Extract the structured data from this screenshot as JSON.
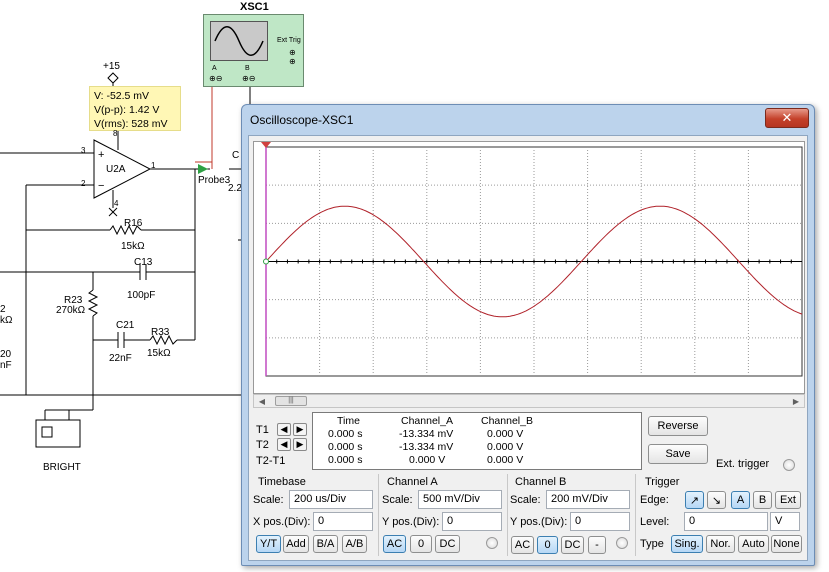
{
  "schematic": {
    "instrument_label": "XSC1",
    "instrument_ext_trig": "Ext Trig",
    "instrument_a": "A",
    "instrument_b": "B",
    "supply": "+15",
    "probe_readout": {
      "v": "V: -52.5 mV",
      "vpp": "V(p-p): 1.42 V",
      "vrms": "V(rms): 528 mV"
    },
    "opamp": "U2A",
    "pin_8": "8",
    "pin_4": "4",
    "pin_3": "3",
    "pin_2": "2",
    "pin_1": "1",
    "probe_label": "Probe3",
    "c_partial": "C",
    "val_partial": "2.2",
    "r16": "R16",
    "r16_val": "15kΩ",
    "c13": "C13",
    "c13_val": "100pF",
    "r23": "R23",
    "r23_val": "270kΩ",
    "c21": "C21",
    "c21_val": "22nF",
    "r33": "R33",
    "r33_val": "15kΩ",
    "left_2": "2",
    "left_kohm": "kΩ",
    "left_20": "20",
    "left_nf": "nF",
    "bright": "BRIGHT"
  },
  "window": {
    "title": "Oscilloscope-XSC1",
    "close": "✕"
  },
  "readout": {
    "headers": [
      "Time",
      "Channel_A",
      "Channel_B"
    ],
    "rows": [
      {
        "label": "T1",
        "time": "0.000 s",
        "a": "-13.334 mV",
        "b": "0.000 V"
      },
      {
        "label": "T2",
        "time": "0.000 s",
        "a": "-13.334 mV",
        "b": "0.000 V"
      },
      {
        "label": "T2-T1",
        "time": "0.000 s",
        "a": "0.000 V",
        "b": "0.000 V"
      }
    ]
  },
  "buttons": {
    "reverse": "Reverse",
    "save": "Save",
    "ext_trigger": "Ext. trigger"
  },
  "timebase": {
    "title": "Timebase",
    "scale_label": "Scale:",
    "scale": "200 us/Div",
    "xpos_label": "X pos.(Div):",
    "xpos": "0",
    "modes": [
      "Y/T",
      "Add",
      "B/A",
      "A/B"
    ]
  },
  "channel_a": {
    "title": "Channel A",
    "scale_label": "Scale:",
    "scale": "500 mV/Div",
    "ypos_label": "Y pos.(Div):",
    "ypos": "0",
    "coupling": [
      "AC",
      "0",
      "DC"
    ]
  },
  "channel_b": {
    "title": "Channel B",
    "scale_label": "Scale:",
    "scale": "200 mV/Div",
    "ypos_label": "Y pos.(Div):",
    "ypos": "0",
    "coupling": [
      "AC",
      "0",
      "DC",
      "-"
    ]
  },
  "trigger": {
    "title": "Trigger",
    "edge_label": "Edge:",
    "edge_rise": "↗",
    "edge_fall": "↘",
    "sources": [
      "A",
      "B",
      "Ext"
    ],
    "level_label": "Level:",
    "level": "0",
    "level_unit": "V",
    "type_label": "Type",
    "types": [
      "Sing.",
      "Nor.",
      "Auto",
      "None"
    ]
  },
  "colors": {
    "trace": "#b0222a",
    "cursor": "#c04bc0",
    "window_frame": "#bcd3ec"
  }
}
